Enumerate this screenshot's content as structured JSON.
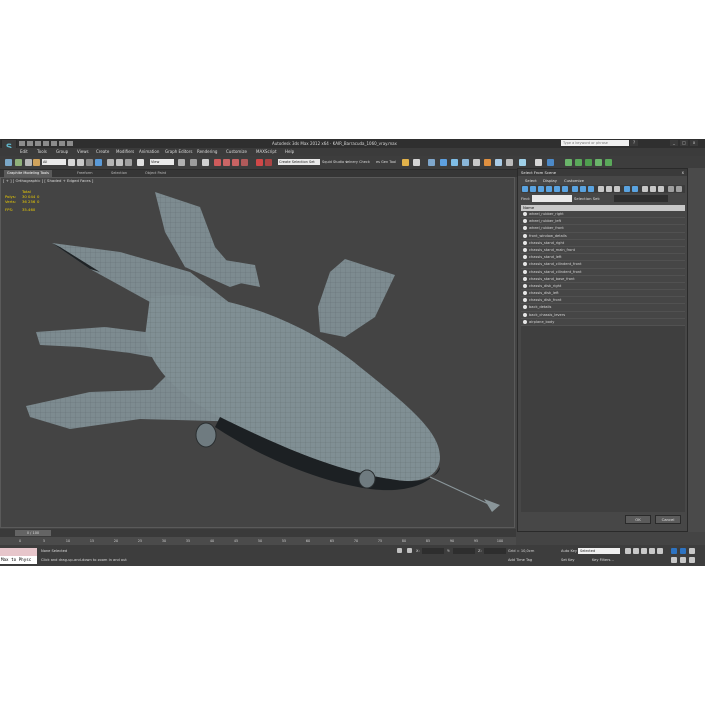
{
  "window": {
    "title": "Autodesk 3ds Max 2012 x64 · KAIR_Barracuda_1060_vray.max",
    "search_placeholder": "Type a keyword or phrase"
  },
  "menu": [
    "Edit",
    "Tools",
    "Group",
    "Views",
    "Create",
    "Modifiers",
    "Animation",
    "Graph Editors",
    "Rendering",
    "Customize",
    "MAXScript",
    "Help"
  ],
  "toolbar": {
    "selection_filter": "All",
    "coord_system": "View",
    "named_selection": "Create Selection Set",
    "status_text_a": "Squid Studio v",
    "status_text_b": "ielnery Check",
    "status_text_c": "es Gen Tool"
  },
  "ribbon_tabs": [
    "Graphite Modeling Tools",
    "Freeform",
    "Selection",
    "Object Paint"
  ],
  "viewport": {
    "label": "[ + ] [ Orthographic ] [ Shaded + Edged Faces ]",
    "stats_header": "Total",
    "polys_label": "Polys:",
    "polys_value": "30 044",
    "polys_sel": "0",
    "verts_label": "Verts:",
    "verts_value": "36 256",
    "verts_sel": "0",
    "fps_label": "FPS:",
    "fps_value": "35.460"
  },
  "timeline": {
    "slider": "0 / 100",
    "ticks": [
      "0",
      "5",
      "10",
      "15",
      "20",
      "25",
      "30",
      "35",
      "40",
      "45",
      "50",
      "55",
      "60",
      "65",
      "70",
      "75",
      "80",
      "85",
      "90",
      "95",
      "100"
    ]
  },
  "statusbar": {
    "macro_text": "Max to Physc",
    "selection": "None Selected",
    "prompt": "Click and drag-up-and-down to zoom in and out",
    "x_label": "X:",
    "y_label": "Y:",
    "z_label": "Z:",
    "grid": "Grid = 10,0cm",
    "add_time_tag": "Add Time Tag",
    "auto_key": "Auto Key",
    "auto_key_mode": "Selected",
    "set_key": "Set Key",
    "key_filters": "Key Filters..."
  },
  "dialog": {
    "title": "Select From Scene",
    "close": "x",
    "menu": [
      "Select",
      "Display",
      "Customize"
    ],
    "find_label": "Find:",
    "selection_set_label": "Selection Set:",
    "column_name": "Name",
    "items": [
      "wheel_rubber_right",
      "wheel_rubber_left",
      "wheel_rubber_front",
      "front_window_details",
      "chassis_stand_right",
      "chassis_stand_main_front",
      "chassis_stand_left",
      "chassis_stand_cilindent_front",
      "chassis_stand_cilindent_front",
      "chassis_stand_base_front",
      "chassis_disk_right",
      "chassis_disk_left",
      "chassis_disk_front",
      "back_details",
      "back_chassis_levers",
      "airplane_body"
    ],
    "ok": "OK",
    "cancel": "Cancel"
  },
  "colors": {
    "accent": "#2d73c2",
    "stats": "#f0d000",
    "viewport_bg": "#444444",
    "model": "#7d8b90"
  }
}
